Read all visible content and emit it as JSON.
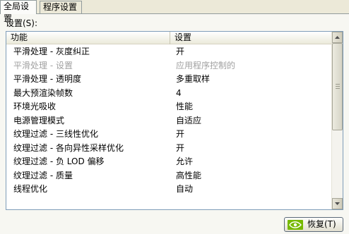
{
  "tabs": [
    {
      "label": "全局设置"
    },
    {
      "label": "程序设置"
    }
  ],
  "section_label": "设置(S):",
  "table": {
    "columns": [
      "功能",
      "设置"
    ],
    "rows": [
      {
        "feature": "平滑处理 - 灰度纠正",
        "value": "开",
        "enabled": true
      },
      {
        "feature": "平滑处理 - 设置",
        "value": "应用程序控制的",
        "enabled": false
      },
      {
        "feature": "平滑处理 - 透明度",
        "value": "多重取样",
        "enabled": true
      },
      {
        "feature": "最大预渲染帧数",
        "value": "4",
        "enabled": true
      },
      {
        "feature": "环境光吸收",
        "value": "性能",
        "enabled": true
      },
      {
        "feature": "电源管理模式",
        "value": "自适应",
        "enabled": true
      },
      {
        "feature": "纹理过滤 - 三线性优化",
        "value": "开",
        "enabled": true
      },
      {
        "feature": "纹理过滤 - 各向异性采样优化",
        "value": "开",
        "enabled": true
      },
      {
        "feature": "纹理过滤 - 负 LOD 偏移",
        "value": "允许",
        "enabled": true
      },
      {
        "feature": "纹理过滤 - 质量",
        "value": "高性能",
        "enabled": true
      },
      {
        "feature": "线程优化",
        "value": "自动",
        "enabled": true
      }
    ]
  },
  "restore_button": {
    "label": "恢复(T)",
    "icon": "nvidia-logo-icon"
  },
  "colors": {
    "logo_green": "#76b900",
    "list_border": "#7f9db9"
  }
}
